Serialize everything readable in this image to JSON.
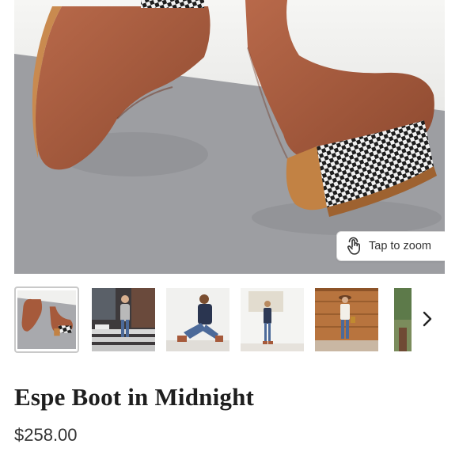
{
  "gallery": {
    "zoom_label": "Tap to zoom",
    "zoom_icon": "tap-hand-icon",
    "next_icon": "chevron-right-icon",
    "thumbnails": [
      {
        "name": "thumb-boots-closeup",
        "selected": true
      },
      {
        "name": "thumb-woman-on-steps"
      },
      {
        "name": "thumb-woman-sitting"
      },
      {
        "name": "thumb-woman-studio"
      },
      {
        "name": "thumb-woman-fence"
      },
      {
        "name": "thumb-partial"
      }
    ]
  },
  "product": {
    "title": "Espe Boot in Midnight",
    "price": "$258.00"
  },
  "colors": {
    "leather": "#a65a3b",
    "background_gray": "#9d9ea2",
    "wood_heel": "#b9793d"
  }
}
